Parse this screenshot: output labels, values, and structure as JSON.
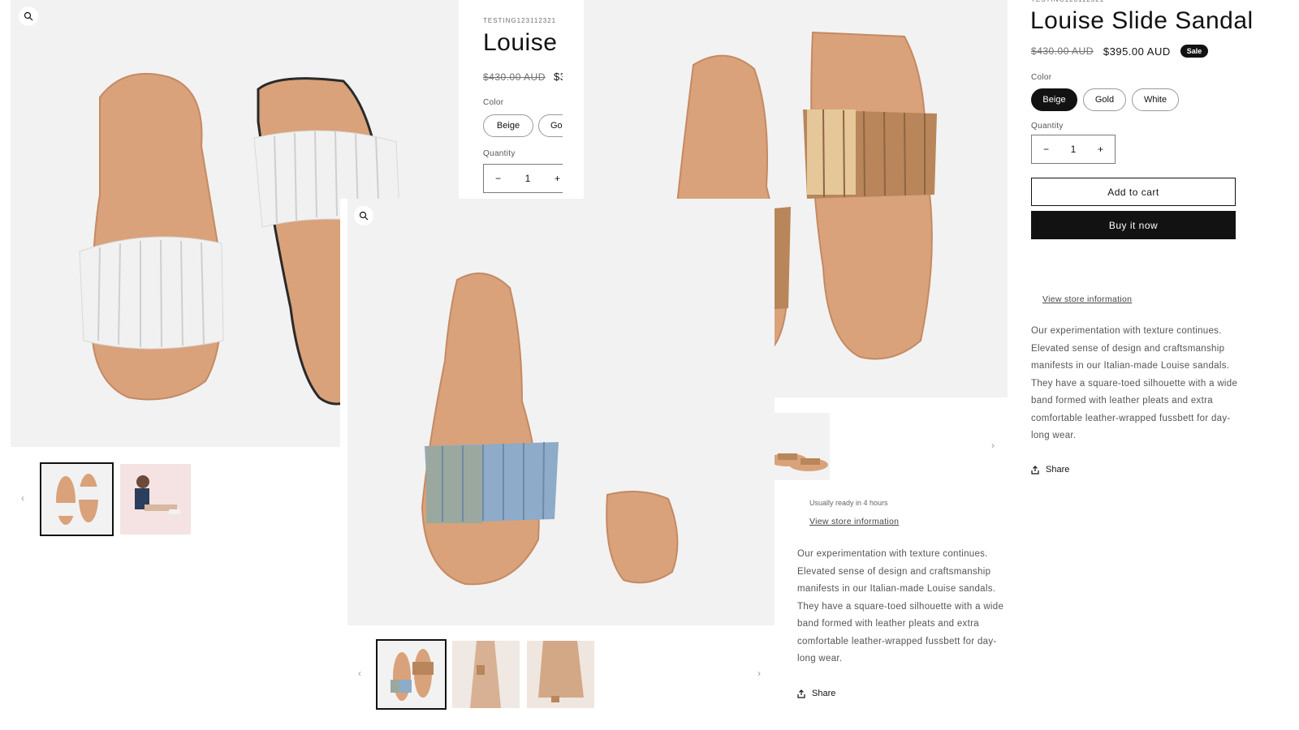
{
  "product": {
    "sku": "TESTING123112321",
    "title": "Louise Slide Sandal",
    "title_cut": "Louise S",
    "price_original": "$430.00 AUD",
    "price_sale": "$395.00 AUD",
    "price_sale_cut": "$3",
    "sale_badge": "Sale"
  },
  "variant": {
    "color_label": "Color",
    "options": [
      "Beige",
      "Gold",
      "White"
    ],
    "option_cut": "Go",
    "selected": "Beige"
  },
  "quantity": {
    "label": "Quantity",
    "value": "1",
    "minus": "−",
    "plus": "+"
  },
  "actions": {
    "add_to_cart": "Add to cart",
    "buy_now": "Buy it now"
  },
  "pickup": {
    "ready_text": "Usually ready in 4 hours",
    "view_store": "View store information"
  },
  "description": {
    "lines": [
      "Our experimentation with texture continues.",
      "Elevated sense of design and craftsmanship",
      "manifests in our Italian-made Louise sandals.",
      "They have a square-toed silhouette with a wide",
      "band formed with leather pleats and extra",
      "comfortable leather-wrapped fussbett for day-",
      "long wear."
    ]
  },
  "share": {
    "label": "Share"
  },
  "nav": {
    "prev": "‹",
    "next": "›"
  },
  "colors": {
    "text": "#121212",
    "image_bg": "#f2f2f2",
    "sole": "#d9a27a",
    "sole_edge": "#c48a63",
    "band_white": "#f1f1f1",
    "band_gold": "#e5c79a",
    "band_tan": "#b8865a",
    "band_blue": "#8eabc9",
    "band_grey": "#9aa89f",
    "button_dark": "#121212"
  },
  "icons": [
    "zoom-icon",
    "share-icon",
    "chevron-left-icon",
    "chevron-right-icon",
    "minus-icon",
    "plus-icon"
  ]
}
